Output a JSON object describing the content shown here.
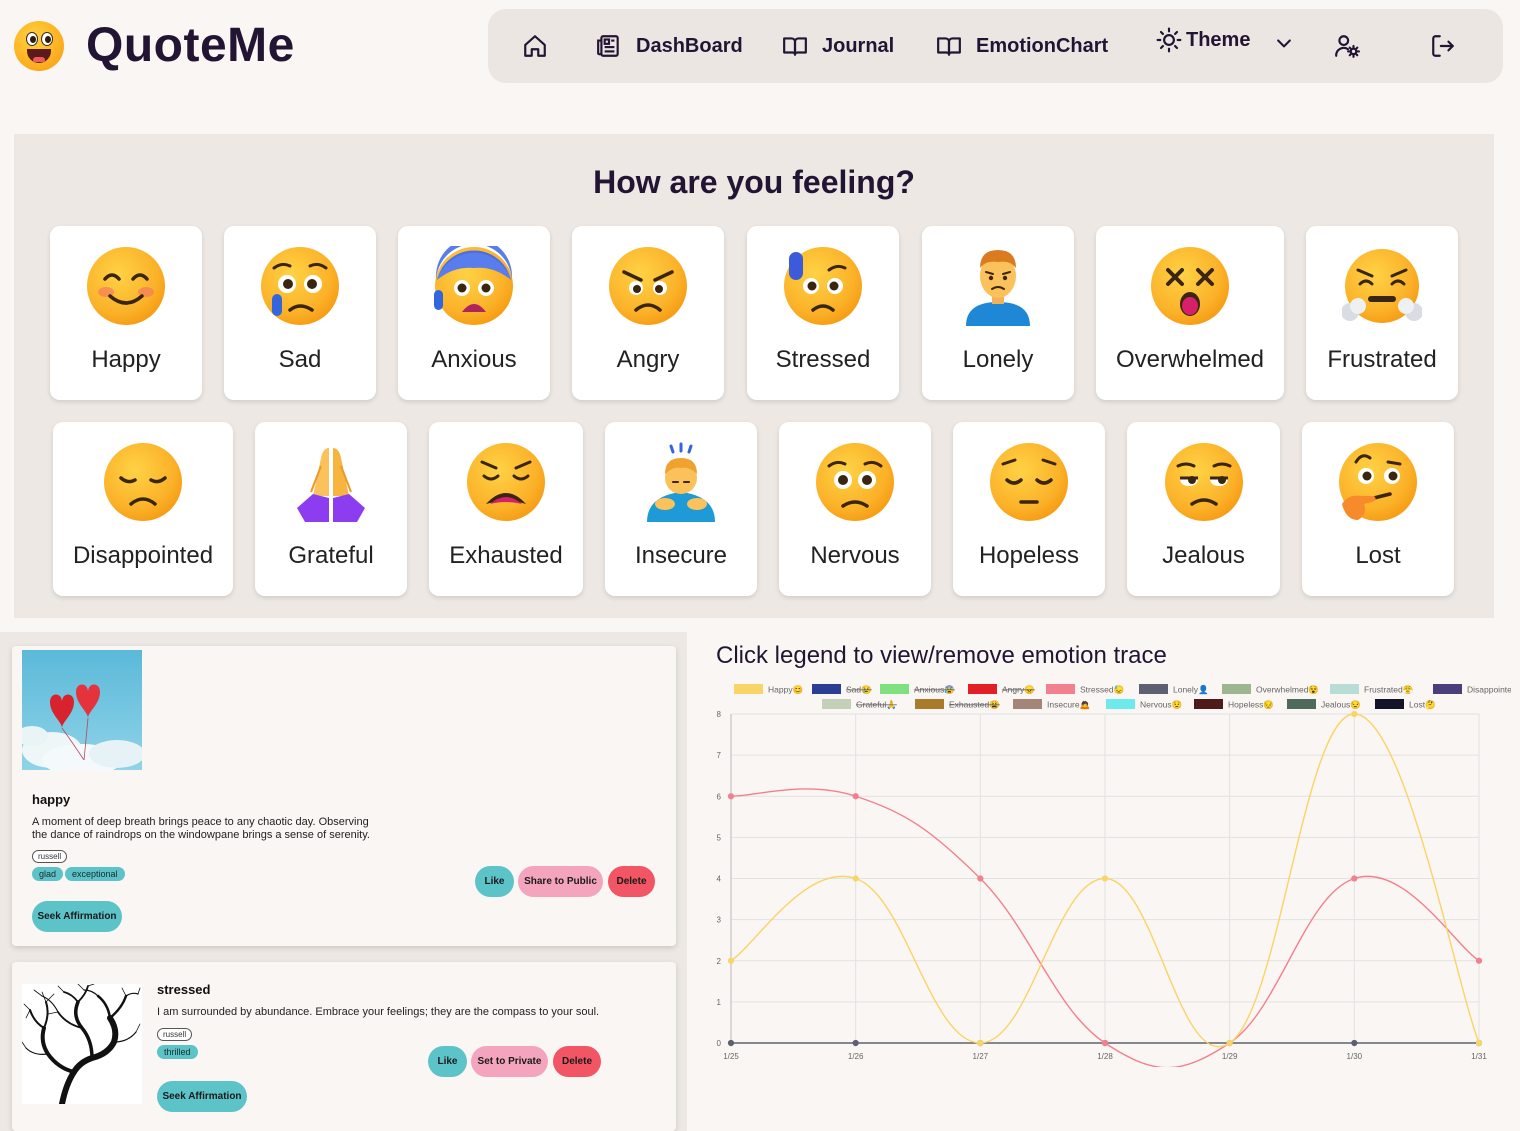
{
  "app": {
    "name": "QuoteMe"
  },
  "nav": {
    "home_icon": "home-icon",
    "dashboard": "DashBoard",
    "journal": "Journal",
    "emotion_chart": "EmotionChart",
    "theme": "Theme",
    "settings_icon": "user-settings-icon",
    "logout_icon": "logout-icon"
  },
  "feelings": {
    "title": "How are you feeling?",
    "items": [
      {
        "label": "Happy",
        "icon": "smiling-face-icon"
      },
      {
        "label": "Sad",
        "icon": "crying-face-icon"
      },
      {
        "label": "Anxious",
        "icon": "anxious-face-icon"
      },
      {
        "label": "Angry",
        "icon": "angry-face-icon"
      },
      {
        "label": "Stressed",
        "icon": "sweat-face-icon"
      },
      {
        "label": "Lonely",
        "icon": "frowning-person-icon"
      },
      {
        "label": "Overwhelmed",
        "icon": "dizzy-face-icon"
      },
      {
        "label": "Frustrated",
        "icon": "steam-face-icon"
      },
      {
        "label": "Disappointed",
        "icon": "disappointed-face-icon"
      },
      {
        "label": "Grateful",
        "icon": "folded-hands-icon"
      },
      {
        "label": "Exhausted",
        "icon": "tired-face-icon"
      },
      {
        "label": "Insecure",
        "icon": "bowing-person-icon"
      },
      {
        "label": "Nervous",
        "icon": "worried-face-icon"
      },
      {
        "label": "Hopeless",
        "icon": "pensive-face-icon"
      },
      {
        "label": "Jealous",
        "icon": "unamused-face-icon"
      },
      {
        "label": "Lost",
        "icon": "thinking-face-icon"
      }
    ]
  },
  "journal": [
    {
      "image": "red-heart-balloons-image",
      "mood": "happy",
      "quote": "A moment of deep breath brings peace to any chaotic day. Observing the dance of raindrops on the windowpane brings a sense of serenity.",
      "author": "russell",
      "tags": [
        "glad",
        "exceptional"
      ],
      "like_label": "Like",
      "visibility_label": "Share to Public",
      "delete_label": "Delete",
      "seek_label": "Seek Affirmation"
    },
    {
      "image": "bare-tree-head-silhouette-image",
      "mood": "stressed",
      "quote": "I am surrounded by abundance. Embrace your feelings; they are the compass to your soul.",
      "author": "russell",
      "tags": [
        "thrilled"
      ],
      "like_label": "Like",
      "visibility_label": "Set to Private",
      "delete_label": "Delete",
      "seek_label": "Seek Affirmation"
    }
  ],
  "chart_data": {
    "type": "line",
    "title": "Click legend to view/remove emotion trace",
    "categories": [
      "1/25",
      "1/26",
      "1/27",
      "1/28",
      "1/29",
      "1/30",
      "1/31"
    ],
    "ylim": [
      0,
      8
    ],
    "yticks": [
      0,
      1,
      2,
      3,
      4,
      5,
      6,
      7,
      8
    ],
    "grid": true,
    "legend_position": "top",
    "legend": [
      {
        "name": "Happy😊",
        "color": "#f9d466",
        "hidden": false
      },
      {
        "name": "Sad😢",
        "color": "#2c3e94",
        "hidden": true
      },
      {
        "name": "Anxious😰",
        "color": "#7fe07f",
        "hidden": true
      },
      {
        "name": "Angry😠",
        "color": "#e21f26",
        "hidden": true
      },
      {
        "name": "Stressed😓",
        "color": "#f3808e",
        "hidden": false
      },
      {
        "name": "Lonely👤",
        "color": "#5d6070",
        "hidden": false
      },
      {
        "name": "Overwhelmed😵",
        "color": "#9db590",
        "hidden": false
      },
      {
        "name": "Frustrated😤",
        "color": "#b8ddd5",
        "hidden": false
      },
      {
        "name": "Disappointed😞",
        "color": "#4a3f7a",
        "hidden": false
      },
      {
        "name": "Grateful🙏",
        "color": "#c3d1b8",
        "hidden": true
      },
      {
        "name": "Exhausted😩",
        "color": "#a87c2a",
        "hidden": true
      },
      {
        "name": "Insecure🙇",
        "color": "#a5857a",
        "hidden": false
      },
      {
        "name": "Nervous😟",
        "color": "#6eeaea",
        "hidden": false
      },
      {
        "name": "Hopeless😔",
        "color": "#4e1a1a",
        "hidden": false
      },
      {
        "name": "Jealous😒",
        "color": "#4e6a5a",
        "hidden": false
      },
      {
        "name": "Lost🤔",
        "color": "#141428",
        "hidden": false
      }
    ],
    "series": [
      {
        "name": "Happy😊",
        "color": "#f9d466",
        "values": [
          2,
          4,
          0,
          4,
          0,
          8,
          0
        ]
      },
      {
        "name": "Stressed😓",
        "color": "#f3808e",
        "values": [
          6,
          6,
          4,
          0,
          0,
          4,
          2
        ]
      },
      {
        "name": "Lonely👤",
        "color": "#5d6070",
        "values": [
          0,
          0,
          0,
          0,
          0,
          0,
          0
        ]
      }
    ]
  }
}
